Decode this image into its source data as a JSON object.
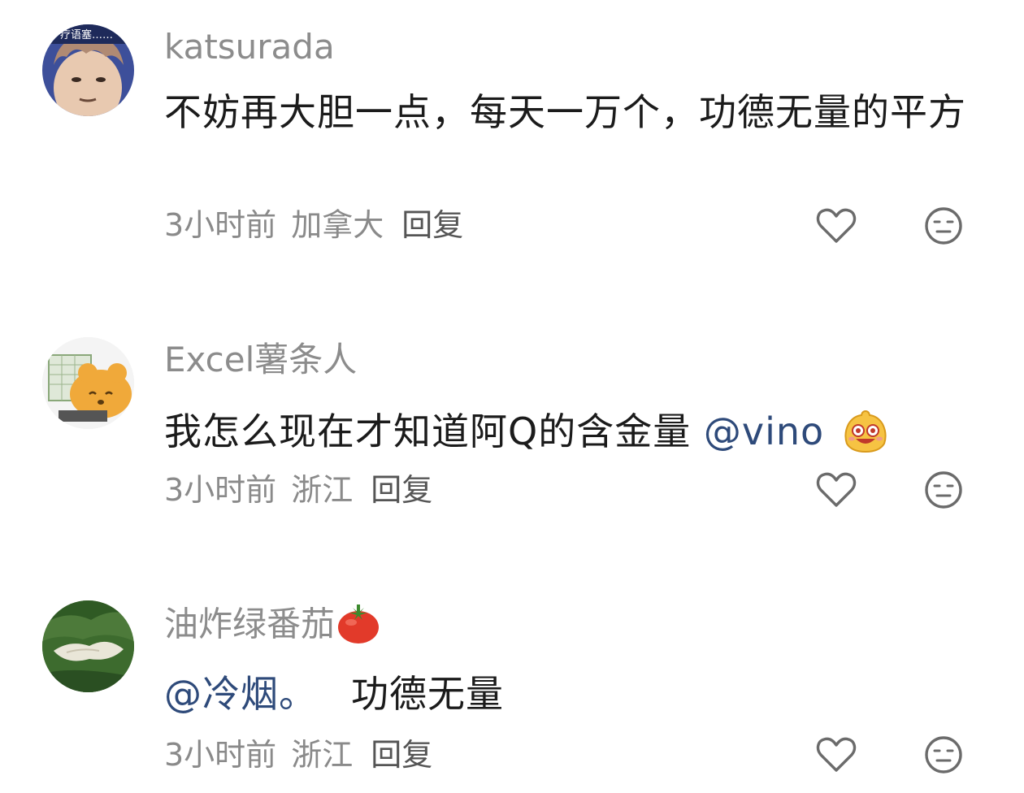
{
  "comments": [
    {
      "username": "katsurada",
      "avatar_overlay": "疗语塞……",
      "text": "不妨再大胆一点，每天一万个，功德无量的平方",
      "time": "3小时前",
      "location": "加拿大",
      "reply": "回复"
    },
    {
      "username": "Excel薯条人",
      "text": "我怎么现在才知道阿Q的含金量",
      "mention": "@vino",
      "time": "3小时前",
      "location": "浙江",
      "reply": "回复"
    },
    {
      "username": "油炸绿番茄",
      "mention": "@冷烟。",
      "text": "功德无量",
      "time": "3小时前",
      "location": "浙江",
      "reply": "回复"
    }
  ],
  "icons": {
    "like": "heart-outline-icon",
    "dislike": "neutral-face-icon",
    "emoji": "laughing-face-emoji",
    "tomato": "tomato-emoji"
  },
  "colors": {
    "username": "#8c8c8c",
    "meta": "#8a8a8a",
    "mention": "#2e4a7a",
    "text": "#1b1b1b",
    "icon": "#6b6b6b"
  }
}
